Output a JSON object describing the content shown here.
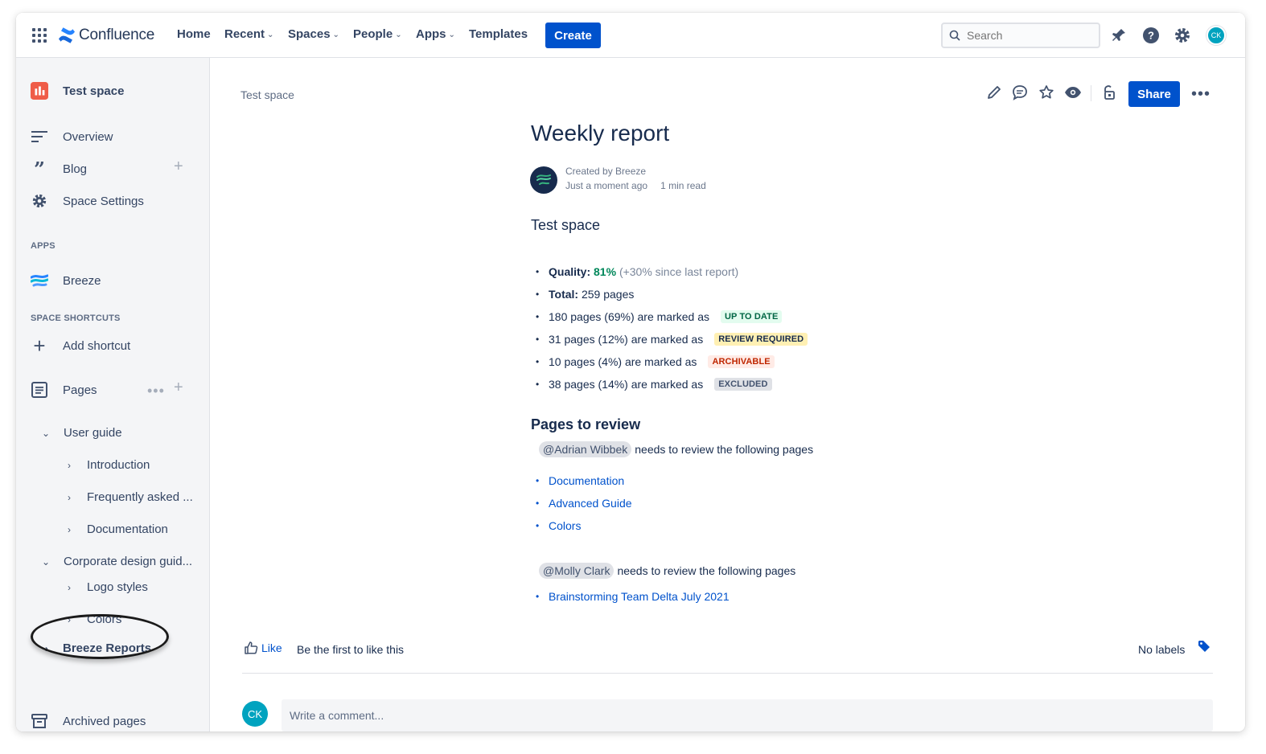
{
  "topnav": {
    "logo_text": "Confluence",
    "nav": [
      {
        "label": "Home",
        "dropdown": false
      },
      {
        "label": "Recent",
        "dropdown": true
      },
      {
        "label": "Spaces",
        "dropdown": true
      },
      {
        "label": "People",
        "dropdown": true
      },
      {
        "label": "Apps",
        "dropdown": true
      },
      {
        "label": "Templates",
        "dropdown": false
      }
    ],
    "create_label": "Create",
    "search_placeholder": "Search",
    "user_initials": "CK",
    "brand_color": "#0052cc"
  },
  "sidebar": {
    "space_name": "Test space",
    "items": {
      "overview": "Overview",
      "blog": "Blog",
      "space_settings": "Space Settings"
    },
    "apps_heading": "APPS",
    "apps": [
      "Breeze"
    ],
    "shortcuts_heading": "SPACE SHORTCUTS",
    "add_shortcut": "Add shortcut",
    "pages_label": "Pages",
    "tree": {
      "user_guide": "User guide",
      "introduction": "Introduction",
      "faq": "Frequently asked ...",
      "documentation": "Documentation",
      "corporate": "Corporate design guid...",
      "logo_styles": "Logo styles",
      "colors": "Colors",
      "breeze_reports": "Breeze Reports"
    },
    "archived": "Archived pages"
  },
  "page": {
    "breadcrumb": "Test space",
    "share_label": "Share",
    "title": "Weekly report",
    "byline": {
      "created_by": "Created by Breeze",
      "time": "Just a moment ago",
      "read_time": "1 min read"
    },
    "section_heading": "Test space",
    "quality": {
      "label": "Quality:",
      "value": "81%",
      "delta": "(+30% since last report)",
      "color": "#00875a"
    },
    "total": {
      "label": "Total:",
      "value": "259 pages"
    },
    "statuses": [
      {
        "text": "180 pages (69%) are marked as",
        "lozenge": "UP TO DATE",
        "bg": "#e3fcef",
        "fg": "#006644"
      },
      {
        "text": "31 pages (12%) are marked as",
        "lozenge": "REVIEW REQUIRED",
        "bg": "#fff0b3",
        "fg": "#172b4d"
      },
      {
        "text": "10 pages (4%) are marked as",
        "lozenge": "ARCHIVABLE",
        "bg": "#ffebe6",
        "fg": "#bf2600"
      },
      {
        "text": "38 pages (14%) are marked as",
        "lozenge": "EXCLUDED",
        "bg": "#dfe1e6",
        "fg": "#42526e"
      }
    ],
    "review_heading": "Pages to review",
    "reviewers": [
      {
        "mention": "@Adrian Wibbek",
        "text": "needs to review the following pages",
        "pages": [
          "Documentation",
          "Advanced Guide",
          "Colors"
        ]
      },
      {
        "mention": "@Molly Clark",
        "text": "needs to review the following pages",
        "pages": [
          "Brainstorming Team Delta July 2021"
        ]
      }
    ],
    "like_label": "Like",
    "like_text": "Be the first to like this",
    "labels_text": "No labels",
    "comment_avatar": "CK",
    "comment_placeholder": "Write a comment..."
  }
}
